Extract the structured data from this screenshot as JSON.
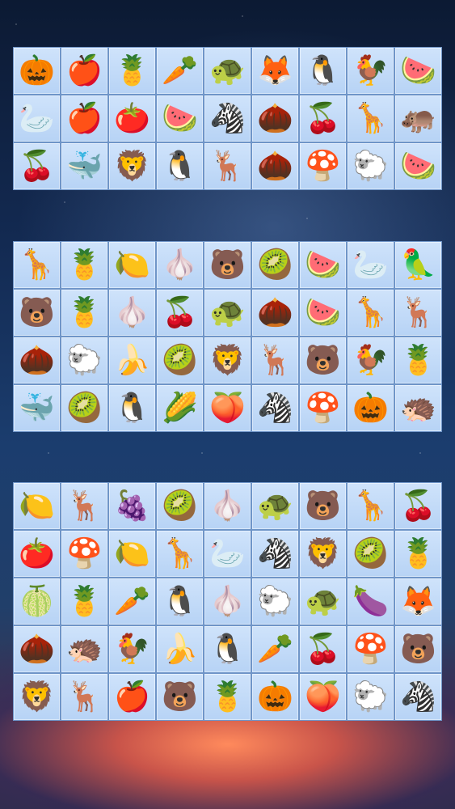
{
  "boards": [
    {
      "cols": 9,
      "tiles": [
        "pumpkin",
        "apple",
        "pineapple",
        "radish",
        "turtle",
        "fox",
        "penguin",
        "rooster",
        "watermelon",
        "swan",
        "apple",
        "tomato",
        "watermelon-whole",
        "zebra",
        "acorn",
        "cherries",
        "giraffe",
        "hippo",
        "cherries",
        "whale",
        "lion",
        "penguin",
        "deer",
        "acorn",
        "mushroom",
        "sheep",
        "watermelon"
      ]
    },
    {
      "cols": 9,
      "tiles": [
        "giraffe",
        "pineapple",
        "lemon",
        "garlic",
        "bear",
        "kiwi",
        "watermelon",
        "swan",
        "parrot",
        "bear",
        "pineapple",
        "garlic",
        "cherries",
        "turtle",
        "acorn",
        "watermelon-whole",
        "giraffe",
        "deer",
        "acorn",
        "sheep",
        "banana",
        "kiwi",
        "lion",
        "deer",
        "bear",
        "rooster",
        "pineapple",
        "whale",
        "kiwi",
        "penguin",
        "corn",
        "peach",
        "zebra",
        "mushroom",
        "pumpkin",
        "hedgehog"
      ]
    },
    {
      "cols": 9,
      "tiles": [
        "lemon",
        "deer",
        "grapes",
        "kiwi",
        "garlic",
        "turtle",
        "bear",
        "giraffe",
        "cherries",
        "tomato",
        "mushroom",
        "lemon",
        "giraffe",
        "swan",
        "zebra",
        "lion",
        "kiwi",
        "pineapple",
        "dragonfruit",
        "pineapple",
        "radish",
        "penguin",
        "garlic",
        "sheep",
        "turtle",
        "eggplant",
        "fox",
        "acorn",
        "hedgehog",
        "rooster",
        "banana",
        "penguin",
        "radish",
        "cherries",
        "mushroom",
        "bear",
        "lion",
        "deer",
        "apple",
        "bear",
        "pineapple",
        "pumpkin",
        "peach",
        "sheep",
        "zebra"
      ]
    }
  ],
  "icons": {
    "pumpkin": "🎃",
    "apple": "🍎",
    "pineapple": "🍍",
    "radish": "🥕",
    "turtle": "🐢",
    "fox": "🦊",
    "penguin": "🐧",
    "rooster": "🐓",
    "watermelon": "🍉",
    "watermelon-whole": "🍉",
    "swan": "🦢",
    "tomato": "🍅",
    "zebra": "🦓",
    "acorn": "🌰",
    "cherries": "🍒",
    "giraffe": "🦒",
    "hippo": "🦛",
    "whale": "🐳",
    "lion": "🦁",
    "deer": "🦌",
    "mushroom": "🍄",
    "sheep": "🐑",
    "lemon": "🍋",
    "garlic": "🧄",
    "bear": "🐻",
    "kiwi": "🥝",
    "parrot": "🦜",
    "banana": "🍌",
    "corn": "🌽",
    "peach": "🍑",
    "hedgehog": "🦔",
    "grapes": "🍇",
    "dragonfruit": "🍈",
    "eggplant": "🍆"
  },
  "colors": {
    "tile_top": "#cfe3fb",
    "tile_bottom": "#b7d3f5",
    "tile_border": "#6f95c8"
  }
}
